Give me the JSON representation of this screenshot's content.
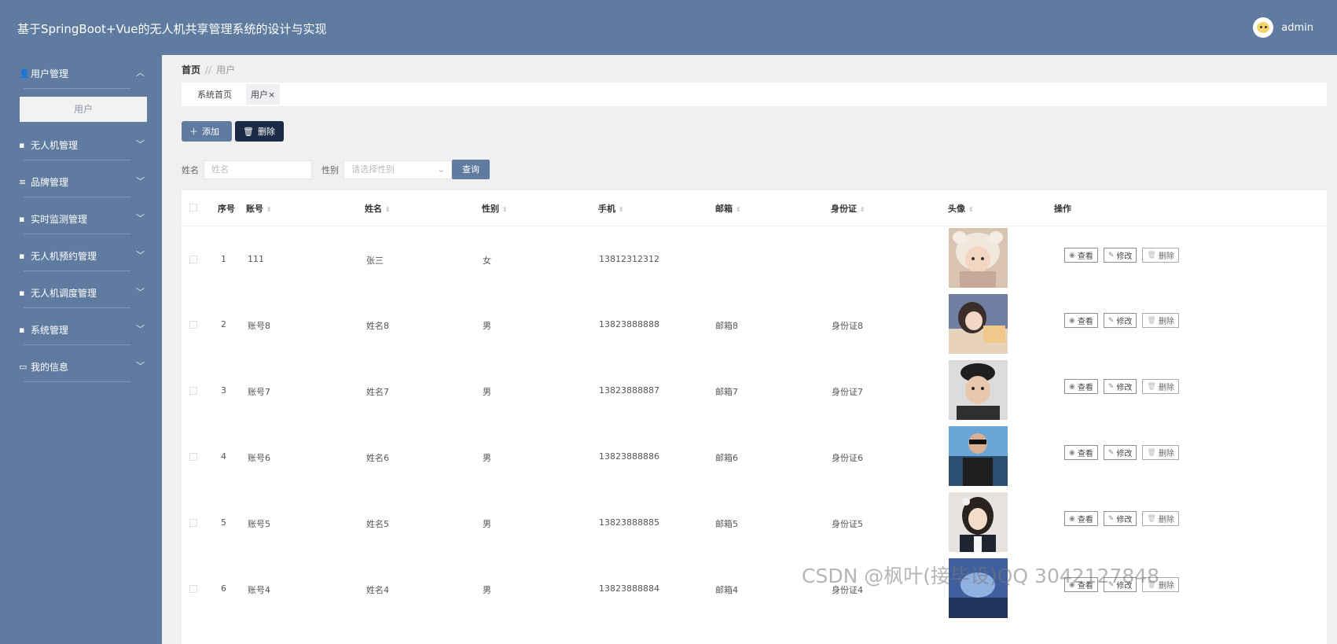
{
  "app": {
    "title": "基于SpringBoot+Vue的无人机共享管理系统的设计与实现",
    "user": "admin"
  },
  "sidebar": {
    "items": [
      {
        "label": "用户管理",
        "icon": "user-icon",
        "glyph": "👤",
        "expanded": true
      },
      {
        "label": "无人机管理",
        "icon": "clipboard-icon",
        "glyph": "▪"
      },
      {
        "label": "品牌管理",
        "icon": "list-icon",
        "glyph": "≡"
      },
      {
        "label": "实时监测管理",
        "icon": "grid-icon",
        "glyph": "▪"
      },
      {
        "label": "无人机预约管理",
        "icon": "clipboard-icon",
        "glyph": "▪"
      },
      {
        "label": "无人机调度管理",
        "icon": "grid-icon",
        "glyph": "▪"
      },
      {
        "label": "系统管理",
        "icon": "monitor-icon",
        "glyph": "▪"
      },
      {
        "label": "我的信息",
        "icon": "id-card-icon",
        "glyph": "▭"
      }
    ],
    "submenu": {
      "label": "用户"
    }
  },
  "breadcrumb": {
    "home": "首页",
    "sep": "//",
    "current": "用户"
  },
  "tabs": [
    {
      "label": "系统首页"
    },
    {
      "label": "用户×"
    }
  ],
  "toolbar": {
    "add_label": "添加",
    "add_glyph": "＋",
    "delete_label": "删除",
    "delete_glyph": "🗑"
  },
  "search": {
    "name_label": "姓名",
    "name_placeholder": "姓名",
    "gender_label": "性别",
    "gender_placeholder": "请选择性别",
    "caret": "⌄",
    "query_label": "查询"
  },
  "table": {
    "columns": {
      "index": "序号",
      "account": "账号",
      "name": "姓名",
      "gender": "性别",
      "phone": "手机",
      "email": "邮箱",
      "idcard": "身份证",
      "avatar": "头像",
      "ops": "操作"
    },
    "sort_glyph": "⇕",
    "op_labels": {
      "view": "查看",
      "edit": "修改",
      "delete": "删除"
    },
    "op_glyphs": {
      "view": "◉",
      "edit": "✎",
      "delete": "🗑"
    },
    "rows": [
      {
        "index": "1",
        "account": "111",
        "name": "张三",
        "gender": "女",
        "phone": "13812312312",
        "email": "",
        "idcard": ""
      },
      {
        "index": "2",
        "account": "账号8",
        "name": "姓名8",
        "gender": "男",
        "phone": "13823888888",
        "email": "邮箱8",
        "idcard": "身份证8"
      },
      {
        "index": "3",
        "account": "账号7",
        "name": "姓名7",
        "gender": "男",
        "phone": "13823888887",
        "email": "邮箱7",
        "idcard": "身份证7"
      },
      {
        "index": "4",
        "account": "账号6",
        "name": "姓名6",
        "gender": "男",
        "phone": "13823888886",
        "email": "邮箱6",
        "idcard": "身份证6"
      },
      {
        "index": "5",
        "account": "账号5",
        "name": "姓名5",
        "gender": "男",
        "phone": "13823888885",
        "email": "邮箱5",
        "idcard": "身份证5"
      },
      {
        "index": "6",
        "account": "账号4",
        "name": "姓名4",
        "gender": "男",
        "phone": "13823888884",
        "email": "邮箱4",
        "idcard": "身份证4"
      }
    ]
  },
  "watermark": "CSDN @枫叶(接毕设)QQ 3042127848",
  "colors": {
    "header": "#5f7ba0",
    "sidebar": "#5f7ba0",
    "primary": "#5f7ba0",
    "danger_dark": "#1b2a47"
  }
}
